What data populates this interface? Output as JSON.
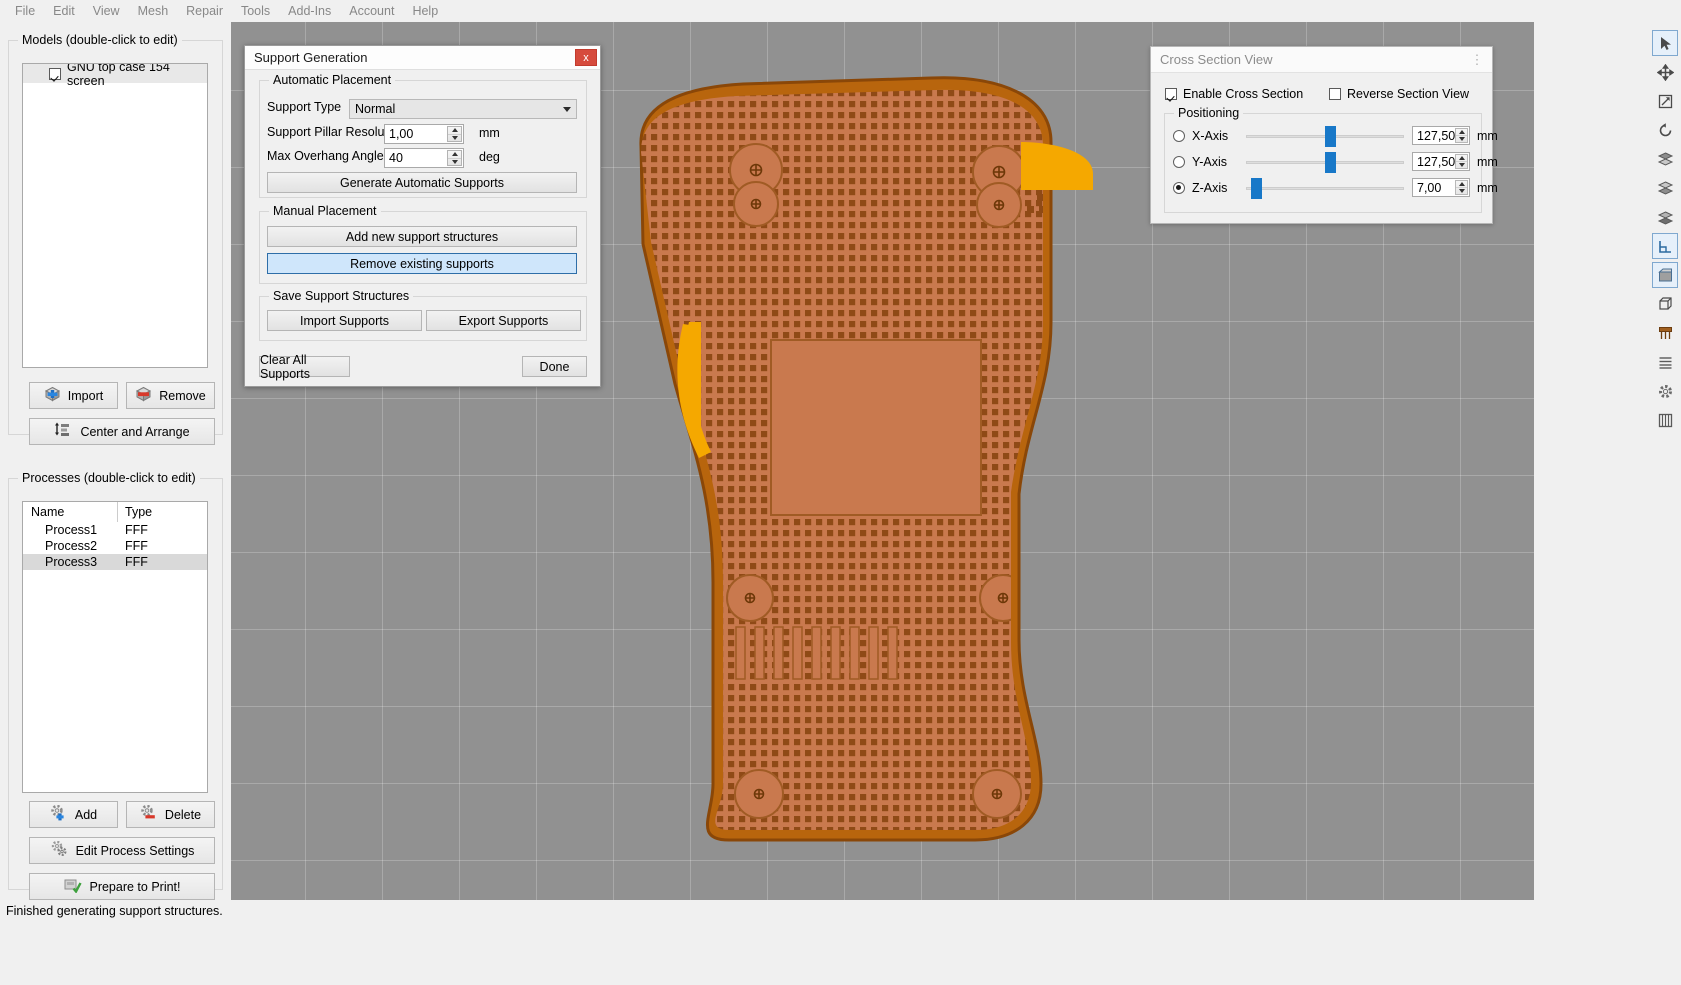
{
  "menu": {
    "items": [
      "File",
      "Edit",
      "View",
      "Mesh",
      "Repair",
      "Tools",
      "Add-Ins",
      "Account",
      "Help"
    ]
  },
  "left_panel": {
    "models": {
      "title": "Models (double-click to edit)",
      "items": [
        {
          "label": "GNU top case 154 screen",
          "checked": true
        }
      ],
      "buttons": {
        "import": "Import",
        "remove": "Remove",
        "center_arrange": "Center and Arrange"
      },
      "icons": {
        "import": "cube-plus-icon",
        "remove": "cube-minus-icon",
        "center_arrange": "center-arrange-icon"
      }
    },
    "processes": {
      "title": "Processes (double-click to edit)",
      "columns": [
        "Name",
        "Type"
      ],
      "rows": [
        {
          "name": "Process1",
          "type": "FFF",
          "selected": false
        },
        {
          "name": "Process2",
          "type": "FFF",
          "selected": false
        },
        {
          "name": "Process3",
          "type": "FFF",
          "selected": true
        }
      ],
      "buttons": {
        "add": "Add",
        "delete": "Delete",
        "edit_process_settings": "Edit Process Settings",
        "prepare_to_print": "Prepare to Print!"
      },
      "icons": {
        "add": "gear-plus-icon",
        "delete": "gear-minus-icon",
        "edit_process_settings": "gears-icon",
        "prepare_to_print": "print-check-icon"
      }
    }
  },
  "support_dialog": {
    "title": "Support Generation",
    "close_label": "x",
    "automatic": {
      "group_title": "Automatic Placement",
      "support_type_label": "Support Type",
      "support_type_value": "Normal",
      "support_type_options": [
        "Normal"
      ],
      "pillar_resolution_label": "Support Pillar Resolution",
      "pillar_resolution_value": "1,00",
      "pillar_resolution_unit": "mm",
      "max_overhang_label": "Max Overhang Angle",
      "max_overhang_value": "40",
      "max_overhang_unit": "deg",
      "generate_button": "Generate Automatic Supports"
    },
    "manual": {
      "group_title": "Manual Placement",
      "add_button": "Add new support structures",
      "remove_button": "Remove existing supports",
      "remove_button_highlighted": true
    },
    "save": {
      "group_title": "Save Support Structures",
      "import_button": "Import Supports",
      "export_button": "Export Supports"
    },
    "footer": {
      "clear_all": "Clear All Supports",
      "done": "Done"
    }
  },
  "cross_section_panel": {
    "title": "Cross Section View",
    "enable_label": "Enable Cross Section",
    "enable_checked": true,
    "reverse_label": "Reverse Section View",
    "reverse_checked": false,
    "positioning_title": "Positioning",
    "axes": [
      {
        "label": "X-Axis",
        "selected": false,
        "value": "127,50",
        "unit": "mm",
        "slider_pct": 50
      },
      {
        "label": "Y-Axis",
        "selected": false,
        "value": "127,50",
        "unit": "mm",
        "slider_pct": 50
      },
      {
        "label": "Z-Axis",
        "selected": true,
        "value": "7,00",
        "unit": "mm",
        "slider_pct": 3
      }
    ]
  },
  "toolstrip": {
    "tools": [
      {
        "name": "cursor-select-icon",
        "active": true
      },
      {
        "name": "move-icon",
        "active": false
      },
      {
        "name": "scale-icon",
        "active": false
      },
      {
        "name": "rotate-icon",
        "active": false
      },
      {
        "name": "stack-top-icon",
        "active": false
      },
      {
        "name": "stack-mid-icon",
        "active": false
      },
      {
        "name": "stack-bottom-icon",
        "active": false
      },
      {
        "name": "cross-section-icon",
        "active": true
      },
      {
        "name": "section-plane-icon",
        "active": true
      },
      {
        "name": "wireframe-cube-icon",
        "active": false
      },
      {
        "name": "support-structure-icon",
        "active": false
      },
      {
        "name": "slice-preview-icon",
        "active": false
      },
      {
        "name": "settings-gear-icon",
        "active": false
      },
      {
        "name": "machine-icon",
        "active": false
      }
    ]
  },
  "statusbar": {
    "message": "Finished generating support structures."
  },
  "colors": {
    "accent_blue": "#1878c8",
    "model_orange": "#b8650d",
    "model_fill": "#c9794e",
    "overhang_yellow": "#f5a800",
    "viewport_gray": "#919191",
    "highlight_blue": "#cfe6fb",
    "close_red": "#d64b3d"
  }
}
